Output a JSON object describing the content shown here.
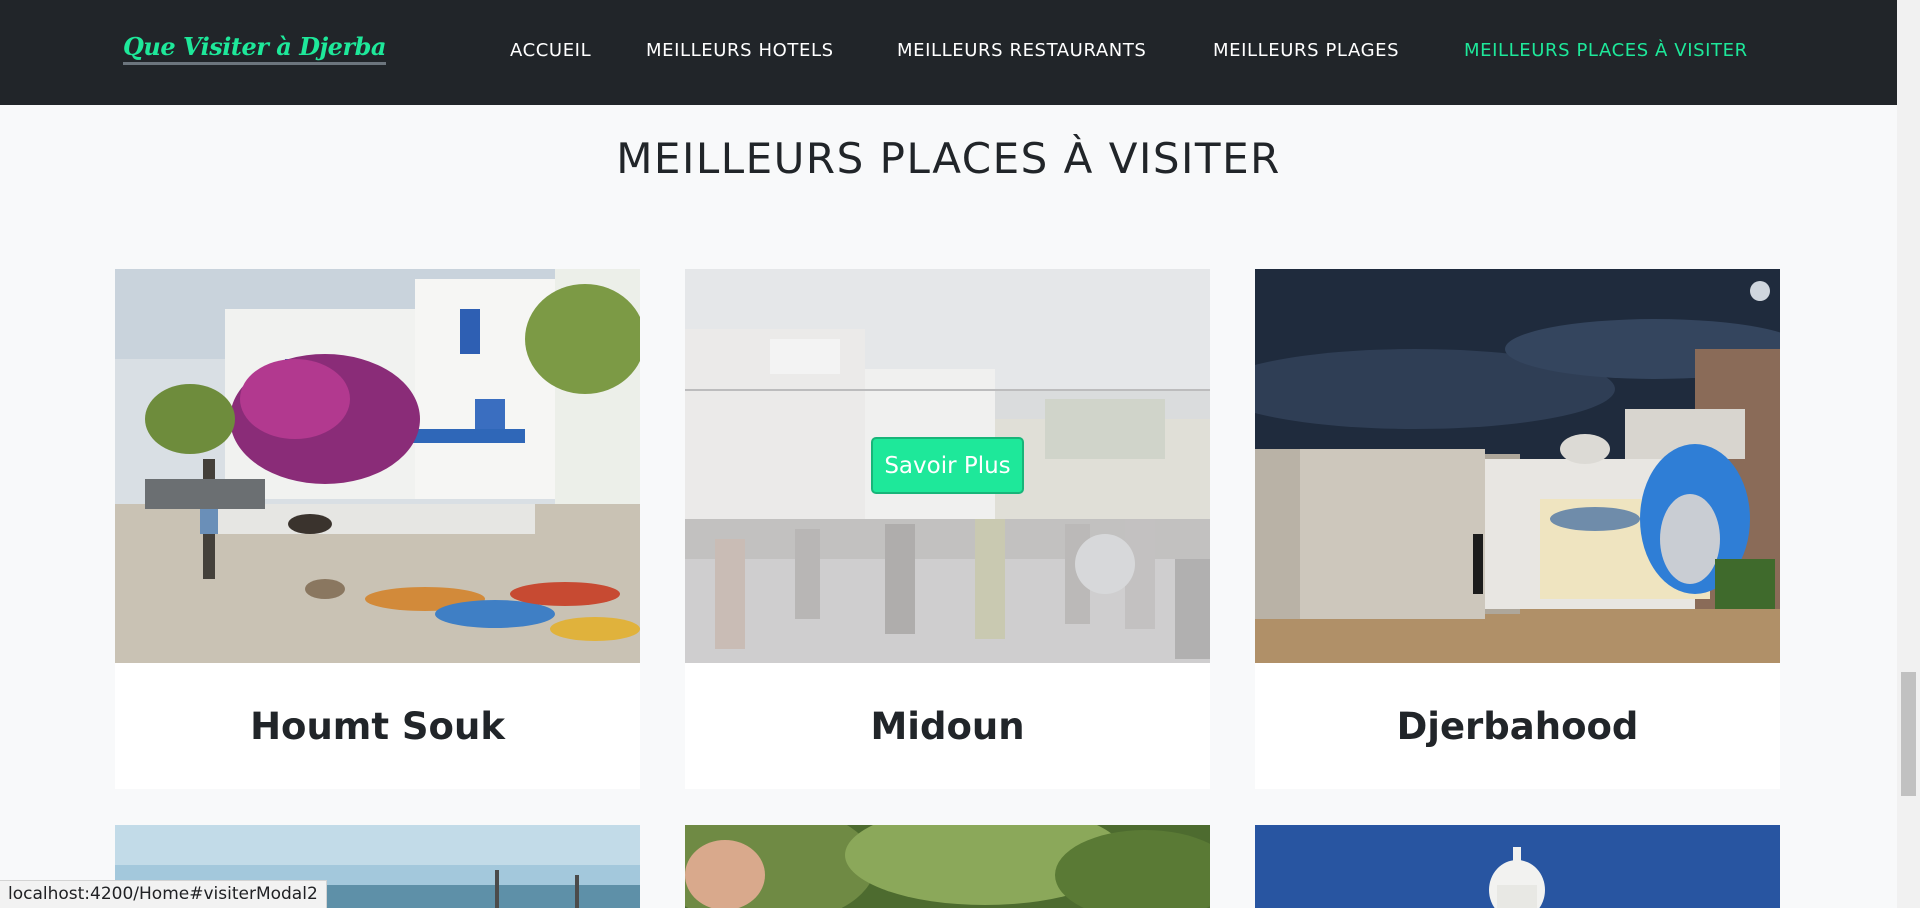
{
  "brand": {
    "title": "Que Visiter à Djerba"
  },
  "nav": {
    "items": [
      {
        "label": "ACCUEIL"
      },
      {
        "label": "MEILLEURS HOTELS"
      },
      {
        "label": "MEILLEURS RESTAURANTS"
      },
      {
        "label": "MEILLEURS PLAGES"
      },
      {
        "label": "MEILLEURS PLACES À VISITER"
      }
    ],
    "active_color": "#1ee89a"
  },
  "section": {
    "title": "MEILLEURS PLACES À VISITER"
  },
  "cards": [
    {
      "name": "Houmt Souk"
    },
    {
      "name": "Midoun",
      "hover_button": "Savoir Plus"
    },
    {
      "name": "Djerbahood"
    }
  ],
  "status_bar": {
    "url": "localhost:4200/Home#visiterModal2"
  },
  "colors": {
    "accent": "#1ee89a",
    "navbar": "#212529",
    "background": "#f8f9fa"
  }
}
